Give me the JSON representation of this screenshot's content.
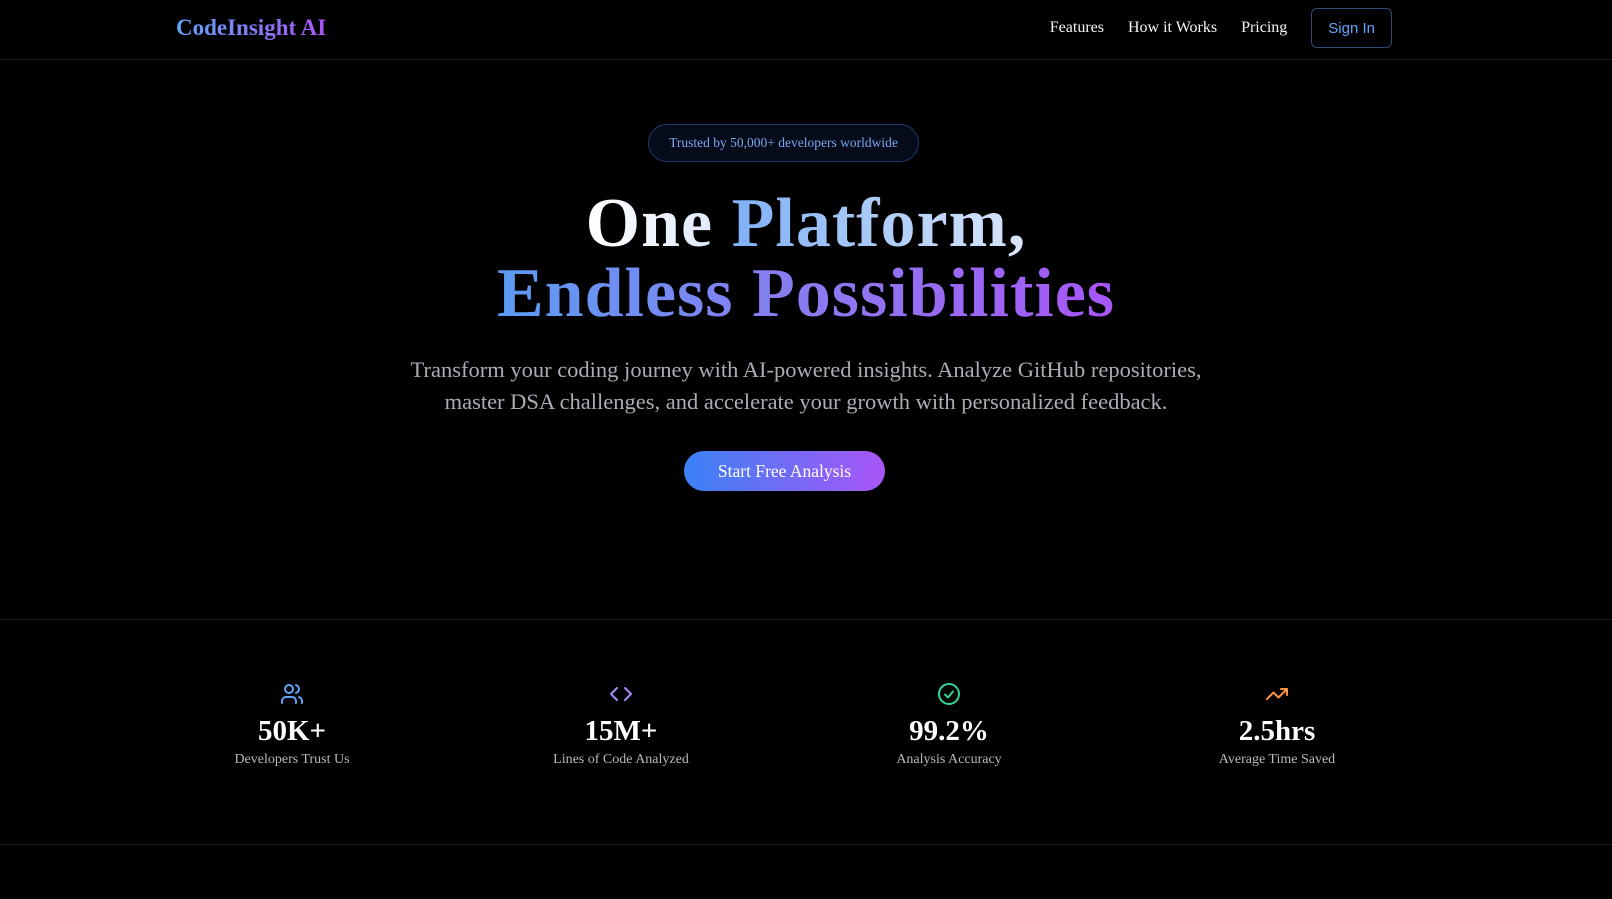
{
  "header": {
    "logo": "CodeInsight AI",
    "nav": [
      "Features",
      "How it Works",
      "Pricing"
    ],
    "signin_label": "Sign In"
  },
  "hero": {
    "badge": "Trusted by 50,000+ developers worldwide",
    "title_line1_part1": "One ",
    "title_line1_part2": "Platform,",
    "title_line2": "Endless Possibilities",
    "subtitle_line1": "Transform your coding journey with AI-powered insights. Analyze GitHub repositories,",
    "subtitle_line2": "master DSA challenges, and accelerate your growth with personalized feedback.",
    "cta_label": "Start Free Analysis"
  },
  "stats": [
    {
      "icon": "users-icon",
      "value": "50K+",
      "label": "Developers Trust Us",
      "color": "#60a5fa"
    },
    {
      "icon": "code-icon",
      "value": "15M+",
      "label": "Lines of Code Analyzed",
      "color": "#a78bfa"
    },
    {
      "icon": "check-circle-icon",
      "value": "99.2%",
      "label": "Analysis Accuracy",
      "color": "#34d399"
    },
    {
      "icon": "trending-up-icon",
      "value": "2.5hrs",
      "label": "Average Time Saved",
      "color": "#fb923c"
    }
  ],
  "colors": {
    "accent_blue": "#3b82f6",
    "accent_purple": "#a855f7",
    "background": "#000000"
  }
}
